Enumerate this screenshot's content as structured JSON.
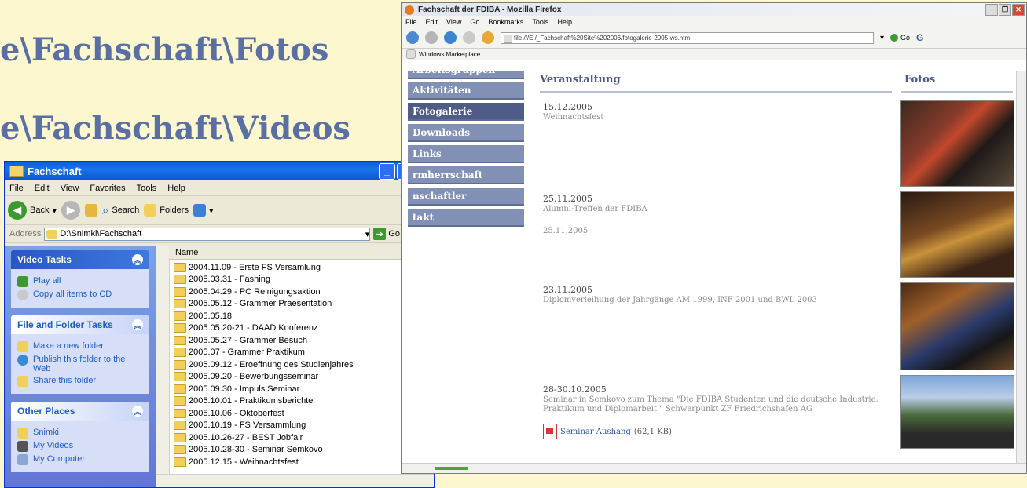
{
  "slide": {
    "path_fotos": "e\\Fachschaft\\Fotos",
    "path_videos": "e\\Fachschaft\\Videos"
  },
  "explorer": {
    "title": "Fachschaft",
    "menu": [
      "File",
      "Edit",
      "View",
      "Favorites",
      "Tools",
      "Help"
    ],
    "toolbar": {
      "back": "Back",
      "search": "Search",
      "folders": "Folders"
    },
    "address": {
      "label": "Address",
      "value": "D:\\Snimki\\Fachschaft",
      "go": "Go"
    },
    "column_name": "Name",
    "tasks": {
      "video": {
        "title": "Video Tasks",
        "items": [
          "Play all",
          "Copy all items to CD"
        ]
      },
      "file_folder": {
        "title": "File and Folder Tasks",
        "items": [
          "Make a new folder",
          "Publish this folder to the Web",
          "Share this folder"
        ]
      },
      "other": {
        "title": "Other Places",
        "items": [
          "Snimki",
          "My Videos",
          "My Computer"
        ]
      }
    },
    "files": [
      "2004.11.09 - Erste FS Versamlung",
      "2005.03.31 - Fashing",
      "2005.04.29 - PC Reinigungsaktion",
      "2005.05.12 - Grammer Praesentation",
      "2005.05.18",
      "2005.05.20-21 - DAAD Konferenz",
      "2005.05.27 - Grammer Besuch",
      "2005.07 - Grammer Praktikum",
      "2005.09.12 - Eroeffnung des Studienjahres",
      "2005.09.20 - Bewerbungsseminar",
      "2005.09.30 - Impuls Seminar",
      "2005.10.01 - Praktikumsberichte",
      "2005.10.06 - Oktoberfest",
      "2005.10.19 - FS Versammlung",
      "2005.10.26-27 - BEST Jobfair",
      "2005.10.28-30 - Seminar Semkovo",
      "2005.12.15 - Weihnachtsfest"
    ]
  },
  "firefox": {
    "title": "Fachschaft der FDIBA - Mozilla Firefox",
    "menu": [
      "File",
      "Edit",
      "View",
      "Go",
      "Bookmarks",
      "Tools",
      "Help"
    ],
    "url": "file:///E:/_Fachschaft%20Site%202006/fotogalerie-2005-ws.htm",
    "go": "Go",
    "bookmark": "Windows Marketplace",
    "nav": [
      "Arbeitsgruppen",
      "Aktivitäten",
      "Fotogalerie",
      "Downloads",
      "Links",
      "rmherrschaft",
      "nschaftler",
      "takt"
    ],
    "header_event": "Veranstaltung",
    "header_photos": "Fotos",
    "events": [
      {
        "date": "15.12.2005",
        "desc": "Weihnachtsfest",
        "extra": ""
      },
      {
        "date": "25.11.2005",
        "desc": "Alumni-Treffen der FDIBA",
        "extra": "25.11.2005"
      },
      {
        "date": "23.11.2005",
        "desc": "Diplomverleihung der Jahrgänge AM 1999, INF 2001 und BWL 2003",
        "extra": ""
      },
      {
        "date": "28-30.10.2005",
        "desc": "Seminar in Semkovo zum Thema \"Die FDIBA Studenten und die deutsche Industrie. Praktikum und Diplomarbeit.\" Schwerpunkt ZF Friedrichshafen AG",
        "extra": ""
      }
    ],
    "pdf": {
      "link": "Seminar Aushang",
      "size": "(62,1 KB)"
    }
  },
  "colors": {
    "slide_bg": "#fcf7cf",
    "slide_text": "#5a6fa3",
    "nav_button": "#8290b5",
    "nav_active": "#4f5c87"
  }
}
